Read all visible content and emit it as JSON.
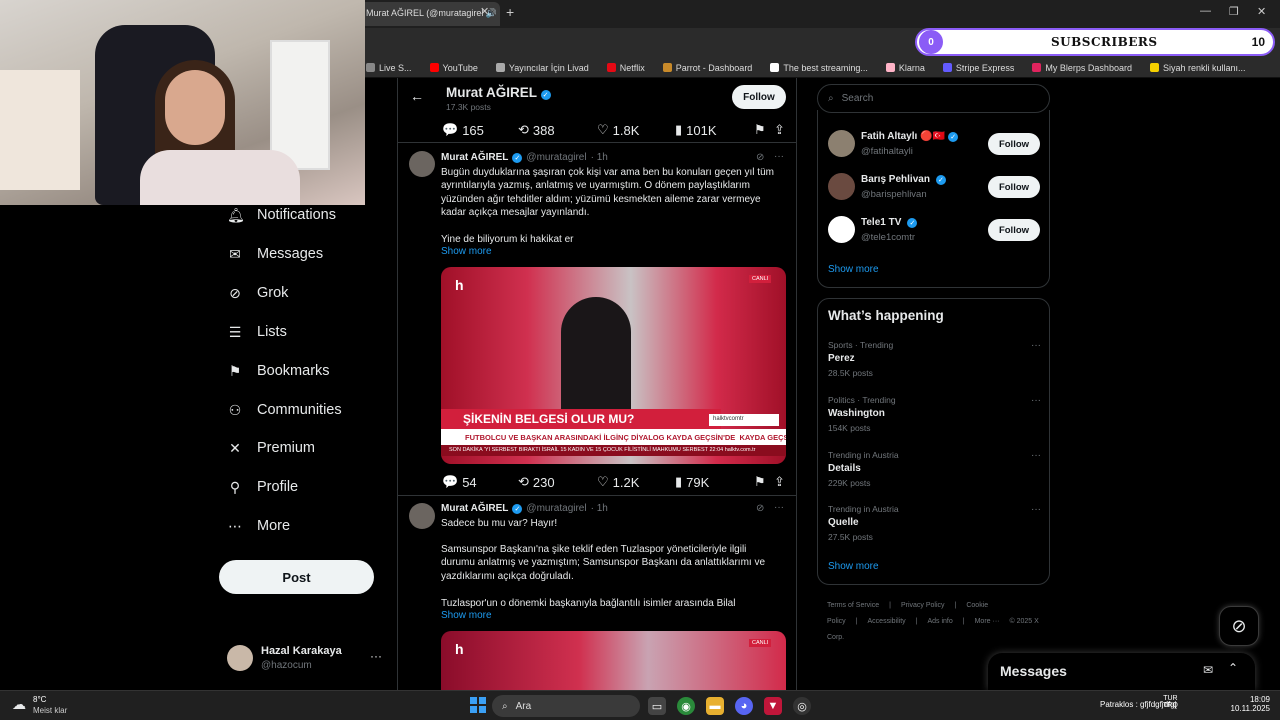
{
  "browser": {
    "tab_title": "Murat AĞIREL (@muratagirel",
    "new_tab": "+",
    "bookmarks": [
      {
        "label": "Live S...",
        "color": "#888888"
      },
      {
        "label": "YouTube",
        "color": "#ff0000"
      },
      {
        "label": "Yayıncılar İçin Livad",
        "color": "#aaaaaa"
      },
      {
        "label": "Netflix",
        "color": "#e50914"
      },
      {
        "label": "Parrot - Dashboard",
        "color": "#c88a2a"
      },
      {
        "label": "The best streaming...",
        "color": "#ffffff"
      },
      {
        "label": "Klarna",
        "color": "#ffb3c7"
      },
      {
        "label": "Stripe Express",
        "color": "#635bff"
      },
      {
        "label": "My Blerps Dashboard",
        "color": "#e0245e"
      },
      {
        "label": "Siyah renkli kullanı...",
        "color": "#f5d000"
      }
    ]
  },
  "subs_overlay": {
    "count": "0",
    "label": "SUBSCRIBERS",
    "right_count": "10"
  },
  "nav": {
    "items": [
      {
        "label": "Notifications",
        "icon": "bell-icon"
      },
      {
        "label": "Messages",
        "icon": "envelope-icon"
      },
      {
        "label": "Grok",
        "icon": "grok-icon"
      },
      {
        "label": "Lists",
        "icon": "list-icon"
      },
      {
        "label": "Bookmarks",
        "icon": "bookmark-icon"
      },
      {
        "label": "Communities",
        "icon": "people-icon"
      },
      {
        "label": "Premium",
        "icon": "x-icon"
      },
      {
        "label": "Profile",
        "icon": "person-icon"
      },
      {
        "label": "More",
        "icon": "more-circle-icon"
      }
    ],
    "post_label": "Post",
    "account": {
      "name": "Hazal Karakaya",
      "handle": "@hazocum",
      "more": "···"
    }
  },
  "profile_header": {
    "name": "Murat AĞIREL",
    "posts": "17.3K posts",
    "follow_label": "Follow"
  },
  "tweets": [
    {
      "actions": {
        "replies": "165",
        "reposts": "388",
        "likes": "1.8K",
        "views": "101K"
      }
    },
    {
      "name": "Murat AĞIREL",
      "handle": "@muratagirel",
      "time": "· 1h",
      "text": "Bugün duyduklarına şaşıran çok kişi var ama ben bu konuları geçen yıl tüm ayrıntılarıyla yazmış, anlatmış ve uyarmıştım. O dönem paylaştıklarım yüzünden ağır tehditler aldım; yüzümü kesmekten aileme zarar vermeye kadar açıkça mesajlar yayınlandı.",
      "text2": "Yine de biliyorum ki hakikat er",
      "show_more": "Show more",
      "media": {
        "logo": "h",
        "live": "CANLI",
        "headline": "ŞİKENİN BELGESİ OLUR MU?",
        "site": "halktvcomtr",
        "subline": "FUTBOLCU VE BAŞKAN ARASINDAKİ İLGİNÇ DİYALOG KAYDA GEÇSİN'DE",
        "tag": "KAYDA GEÇSİN",
        "ticker": "SON DAKİKA  'YI SERBEST BIRAKTI    İSRAİL 15 KADIN VE 15 ÇOCUK FİLİSTİNLİ MAHKUMU SERBEST    22:04    halktv.com.tr"
      },
      "actions": {
        "replies": "54",
        "reposts": "230",
        "likes": "1.2K",
        "views": "79K"
      }
    },
    {
      "name": "Murat AĞIREL",
      "handle": "@muratagirel",
      "time": "· 1h",
      "text": "Sadece bu mu var? Hayır!",
      "text2": "Samsunspor Başkanı'na şike teklif eden Tuzlaspor yöneticileriyle ilgili durumu anlatmış ve yazmıştım; Samsunspor Başkanı da anlattıklarımı ve yazdıklarımı açıkça doğruladı.",
      "text3": "Tuzlaspor'un o dönemki başkanıyla bağlantılı isimler arasında Bilal",
      "show_more": "Show more",
      "media_live": "CANLI"
    }
  ],
  "right": {
    "search_placeholder": "Search",
    "who_to_follow": [
      {
        "name": "Fatih Altaylı",
        "handle": "@fatihaltayli",
        "follow": "Follow",
        "avatar_color": "#8c8070",
        "extra": "🔴🇹🇷"
      },
      {
        "name": "Barış Pehlivan",
        "handle": "@barispehlivan",
        "follow": "Follow",
        "avatar_color": "#6a4a40",
        "extra": ""
      },
      {
        "name": "Tele1 TV",
        "handle": "@tele1comtr",
        "follow": "Follow",
        "avatar_color": "#ffffff",
        "extra": ""
      }
    ],
    "who_show_more": "Show more",
    "trending_title": "What’s happening",
    "trends": [
      {
        "category": "Sports · Trending",
        "name": "Perez",
        "count": "28.5K posts"
      },
      {
        "category": "Politics · Trending",
        "name": "Washington",
        "count": "154K posts"
      },
      {
        "category": "Trending in Austria",
        "name": "Details",
        "count": "229K posts"
      },
      {
        "category": "Trending in Austria",
        "name": "Quelle",
        "count": "27.5K posts"
      }
    ],
    "trends_show_more": "Show more",
    "footer": [
      "Terms of Service",
      "|",
      "Privacy Policy",
      "|",
      "Cookie Policy",
      "|",
      "Accessibility",
      "|",
      "Ads info",
      "|",
      "More ···",
      "© 2025 X Corp."
    ]
  },
  "messages_drawer": {
    "title": "Messages"
  },
  "taskbar": {
    "weather_temp": "8°C",
    "weather_desc": "Meist klar",
    "search_label": "Ara",
    "tray_text": "Patraklos : gfjfdgfjdfgj",
    "lang": "TUR",
    "lang2": "TRQ",
    "time": "18:09",
    "date": "10.11.2025"
  }
}
